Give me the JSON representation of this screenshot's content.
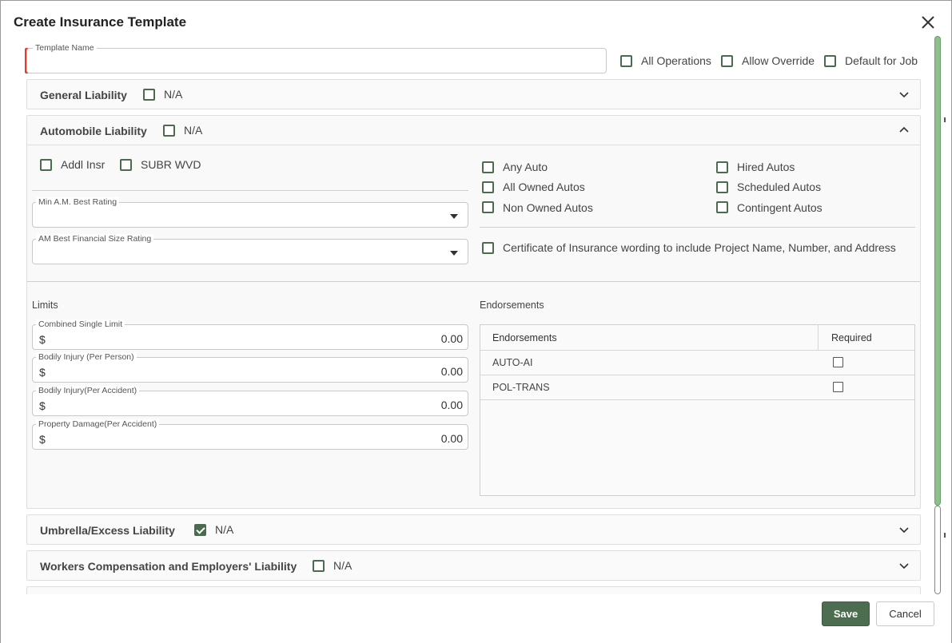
{
  "dialog": {
    "title": "Create Insurance Template"
  },
  "template": {
    "name_label": "Template Name",
    "name_value": "",
    "options": [
      {
        "label": "All Operations",
        "checked": false
      },
      {
        "label": "Allow Override",
        "checked": false
      },
      {
        "label": "Default for Job",
        "checked": false
      }
    ]
  },
  "sections": {
    "general_liability": {
      "title": "General Liability",
      "na_label": "N/A",
      "na_checked": false,
      "expanded": false
    },
    "automobile_liability": {
      "title": "Automobile Liability",
      "na_label": "N/A",
      "na_checked": false,
      "expanded": true
    },
    "umbrella": {
      "title": "Umbrella/Excess Liability",
      "na_label": "N/A",
      "na_checked": true,
      "expanded": false
    },
    "workers_comp": {
      "title": "Workers Compensation and Employers' Liability",
      "na_label": "N/A",
      "na_checked": false,
      "expanded": false
    }
  },
  "auto": {
    "addl_insr": "Addl Insr",
    "subr_wvd": "SUBR WVD",
    "min_am_best_rating_label": "Min A.M. Best Rating",
    "min_am_best_rating_value": "",
    "am_best_financial_size_label": "AM Best Financial Size Rating",
    "am_best_financial_size_value": "",
    "coverage_options": [
      {
        "label": "Any Auto",
        "checked": false
      },
      {
        "label": "All Owned Autos",
        "checked": false
      },
      {
        "label": "Non Owned Autos",
        "checked": false
      },
      {
        "label": "Hired Autos",
        "checked": false
      },
      {
        "label": "Scheduled Autos",
        "checked": false
      },
      {
        "label": "Contingent Autos",
        "checked": false
      }
    ],
    "certificate_wording": "Certificate of Insurance wording to include Project Name, Number, and Address",
    "limits_heading": "Limits",
    "limits": [
      {
        "label": "Combined Single Limit",
        "currency": "$",
        "value": "0.00"
      },
      {
        "label": "Bodily Injury (Per Person)",
        "currency": "$",
        "value": "0.00"
      },
      {
        "label": "Bodily Injury(Per Accident)",
        "currency": "$",
        "value": "0.00"
      },
      {
        "label": "Property Damage(Per Accident)",
        "currency": "$",
        "value": "0.00"
      }
    ],
    "endorsements_heading": "Endorsements",
    "endorsements_table": {
      "columns": [
        "Endorsements",
        "Required"
      ],
      "rows": [
        {
          "name": "AUTO-AI",
          "required": false
        },
        {
          "name": "POL-TRANS",
          "required": false
        }
      ]
    }
  },
  "footer": {
    "save_label": "Save",
    "cancel_label": "Cancel"
  },
  "colors": {
    "accent": "#4c6d4f",
    "required_marker": "#e23b2e",
    "scroll_thumb": "#8fbf8f"
  }
}
